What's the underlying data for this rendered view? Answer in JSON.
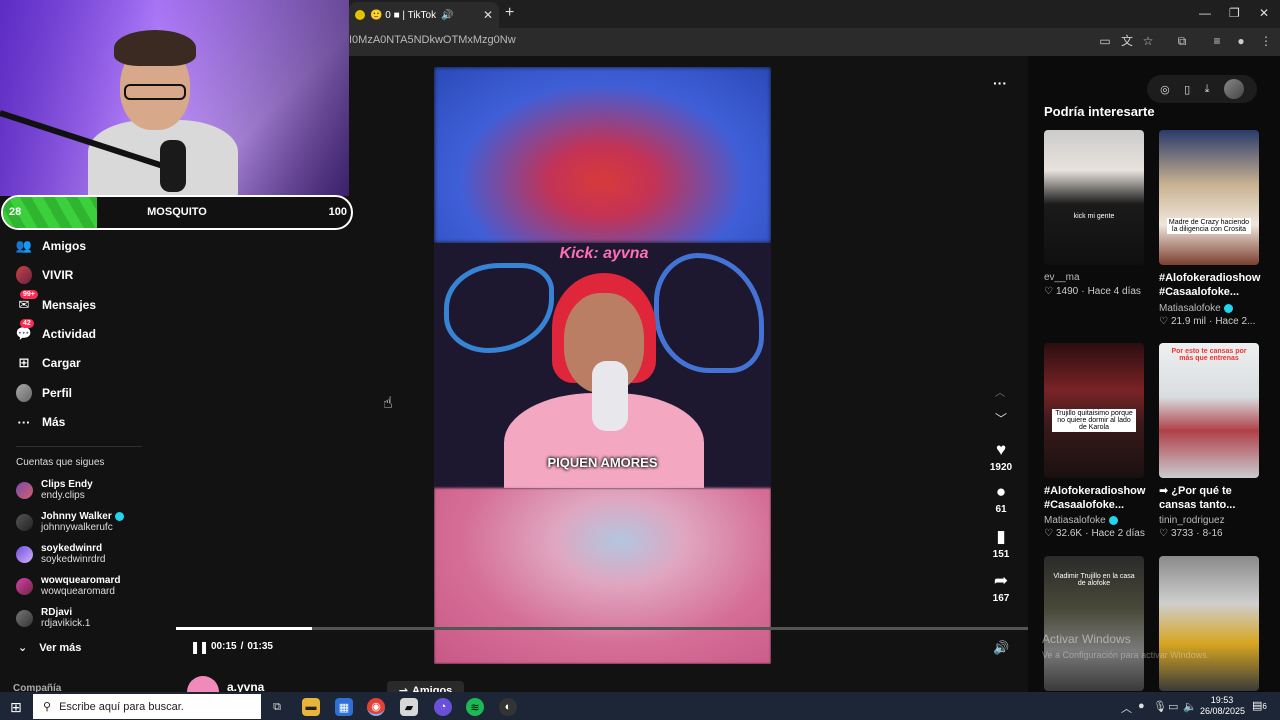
{
  "browser": {
    "tab_title": "🙂 0 ■ | TikTok",
    "tab_close": "✕",
    "newtab": "+",
    "url": "I0MzA0NTA5NDkwOTMxMzg0Nw"
  },
  "overlay": {
    "min": "28",
    "label": "MOSQUITO",
    "max": "100",
    "level": 0.27
  },
  "sidebar": {
    "items": [
      {
        "label": "Amigos",
        "icon": "👥"
      },
      {
        "label": "VIVIR",
        "icon": ""
      },
      {
        "label": "Mensajes",
        "icon": "✉",
        "badge": "99+"
      },
      {
        "label": "Actividad",
        "icon": "💬",
        "badge": "42"
      },
      {
        "label": "Cargar",
        "icon": "⊞"
      },
      {
        "label": "Perfil",
        "icon": ""
      },
      {
        "label": "Más",
        "icon": "···"
      }
    ],
    "following_title": "Cuentas que sigues",
    "following": [
      {
        "name": "Clips Endy",
        "handle": "endy.clips",
        "verified": false
      },
      {
        "name": "Johnny Walker",
        "handle": "johnnywalkerufc",
        "verified": true
      },
      {
        "name": "soykedwinrd",
        "handle": "soykedwinrdrd",
        "verified": false
      },
      {
        "name": "wowquearomard",
        "handle": "wowquearomard",
        "verified": false
      },
      {
        "name": "RDjavi",
        "handle": "rdjavikick.1",
        "verified": false
      }
    ],
    "see_more": "Ver más",
    "company": "Compañía"
  },
  "video": {
    "watermark": "Kick: ayvna",
    "caption": "PIQUEN AMORES",
    "current_time": "00:15",
    "separator": "/",
    "duration": "01:35",
    "progress": 0.16,
    "likes": "1920",
    "comments": "61",
    "saves": "151",
    "shares": "167",
    "author": "a.yvna",
    "friends_button": "Amigos"
  },
  "right": {
    "title": "Podría interesarte",
    "items": [
      {
        "title": "",
        "author": "ev__ma",
        "likes": "1490",
        "date": "Hace 4 días",
        "verified": false,
        "thumb_text": "kick mi gente"
      },
      {
        "title": "#Alofokeradioshow #Casaalofoke...",
        "author": "Matiasalofoke",
        "likes": "21.9 mil",
        "date": "Hace 2...",
        "verified": true,
        "thumb_text": "Madre de Crazy haciendo la diligencia con Crosita"
      },
      {
        "title": "#Alofokeradioshow #Casaalofoke...",
        "author": "Matiasalofoke",
        "likes": "32.6K",
        "date": "Hace 2 días",
        "verified": true,
        "thumb_text": "Trujillo quitaisimo porque no quiere dormir al lado de Karola"
      },
      {
        "title": "➡ ¿Por qué te cansas tanto...",
        "author": "tinin_rodriguez",
        "likes": "3733",
        "date": "8-16",
        "verified": false,
        "thumb_text": "Por esto te cansas por más que entrenas"
      },
      {
        "title": "",
        "author": "",
        "likes": "",
        "date": "",
        "verified": false,
        "thumb_text": "Vladimir Trujillo en la casa de alofoke"
      },
      {
        "title": "",
        "author": "",
        "likes": "",
        "date": "",
        "verified": false,
        "thumb_text": ""
      }
    ],
    "activate_line1": "Activar Windows",
    "activate_line2": "Ve a Configuración para activar Windows."
  },
  "taskbar": {
    "search_placeholder": "Escribe aquí para buscar.",
    "time": "19:53",
    "date": "26/08/2025",
    "notifications": "6"
  },
  "colors": {
    "accent": "#fe2c55",
    "verified": "#20d5ec",
    "overlay_fill": "#3cd03c"
  }
}
